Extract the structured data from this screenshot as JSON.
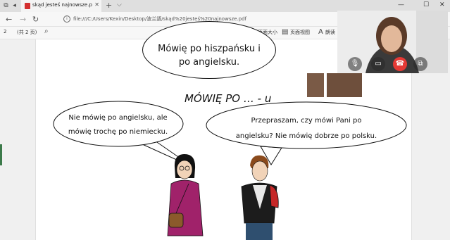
{
  "browser": {
    "tab_title": "skąd jesteś najnowsze.p",
    "tab_close": "✕",
    "new_tab": "+",
    "tab_chevron": "⌵",
    "url": "file:///C:/Users/Kexin/Desktop/波兰語/skąd%20jesteś%20najnowsze.pdf",
    "info": "i"
  },
  "window_controls": {
    "minimize": "—",
    "maximize": "☐",
    "close": "✕"
  },
  "nav": {
    "back": "←",
    "forward": "→",
    "refresh": "↻"
  },
  "pdf_toolbar": {
    "page_number": "2",
    "page_total": "(共 2 页)",
    "search_icon": "⌕",
    "zoom_out": "—",
    "zoom_in": "+",
    "rotate": "↻",
    "fit": "⤢",
    "fit_page_label": "适应页面大小",
    "page_view_label": "页面视图",
    "read_aloud_label": "朗读",
    "more_icon": "⋯"
  },
  "document": {
    "top_bubble_line1": "Mówię po hiszpańsku i",
    "top_bubble_line2": "po angielsku.",
    "heading": "MÓWIĘ PO … - u",
    "left_bubble_line1": "Nie mówię po angielsku, ale",
    "left_bubble_line2": "mówię trochę po niemiecku.",
    "right_bubble_line1": "Przepraszam, czy mówi Pani po",
    "right_bubble_line2": "angielsku? Nie mówię dobrze po polsku."
  },
  "video_call": {
    "controls": [
      "mic-off-icon",
      "camera-off-icon",
      "end-call-icon",
      "switch-view-icon"
    ],
    "end_call_color": "#e53935"
  },
  "colors": {
    "woman_coat": "#a0226a",
    "woman_bag": "#8b5a2b",
    "man_backpack": "#c62828",
    "man_shirt": "#e8e8e8"
  }
}
